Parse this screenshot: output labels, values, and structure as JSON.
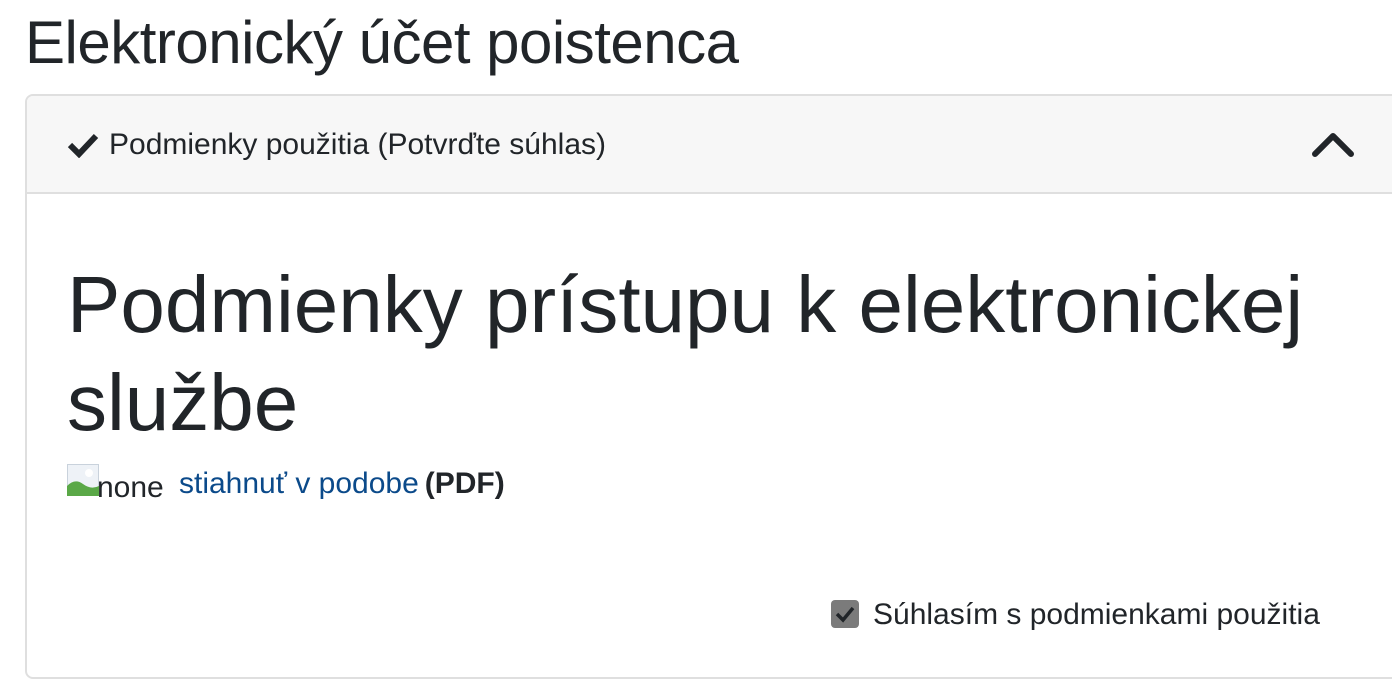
{
  "page": {
    "title": "Elektronický účet poistenca"
  },
  "accordion": {
    "header_label": "Podmienky použitia (Potvrďte súhlas)",
    "header_icon": "check-icon",
    "toggle_icon": "chevron-up-icon",
    "expanded": true
  },
  "content": {
    "heading": "Podmienky prístupu k elektronickej službe",
    "download": {
      "image_alt": "none",
      "link_text": "stiahnuť v podobe",
      "format_label": "(PDF)",
      "link_color": "#0b4a8a"
    },
    "agreement": {
      "label": "Súhlasím s podmienkami použitia",
      "checked": true
    }
  }
}
